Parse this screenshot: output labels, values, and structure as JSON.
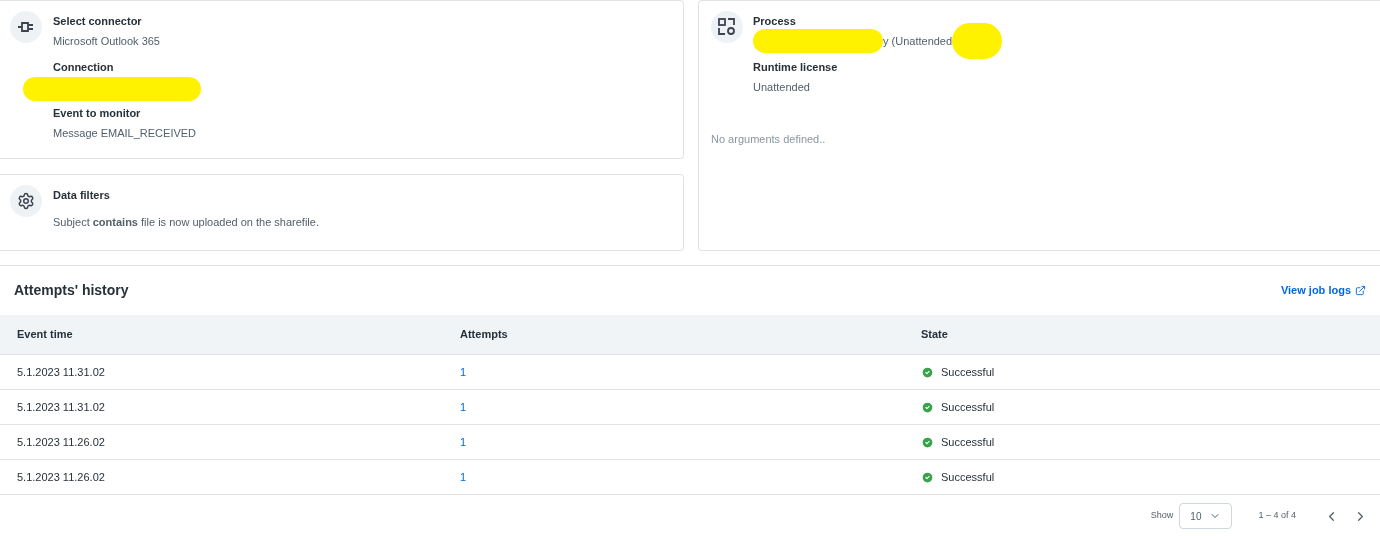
{
  "trigger_card": {
    "fields": [
      {
        "label": "Select connector",
        "value": "Microsoft Outlook 365"
      },
      {
        "label": "Connection",
        "redacted": true
      },
      {
        "label": "Event to monitor",
        "value": "Message EMAIL_RECEIVED"
      }
    ]
  },
  "filters_card": {
    "title": "Data filters",
    "text": "Subject **contains** file is now uploaded on the sharefile."
  },
  "process_card": {
    "fields": [
      {
        "label": "Process",
        "value": "y (Unattended",
        "redacted": true
      },
      {
        "label": "Runtime license",
        "value": "Unattended"
      }
    ],
    "note": "No arguments defined.."
  },
  "history": {
    "title": "Attempts' history",
    "link": "View job logs",
    "columns": [
      "Event time",
      "Attempts",
      "State"
    ],
    "rows": [
      {
        "time": "5.1.2023 11.31.02",
        "attempts": "1",
        "state": "Successful"
      },
      {
        "time": "5.1.2023 11.31.02",
        "attempts": "1",
        "state": "Successful"
      },
      {
        "time": "5.1.2023 11.26.02",
        "attempts": "1",
        "state": "Successful"
      },
      {
        "time": "5.1.2023 11.26.02",
        "attempts": "1",
        "state": "Successful"
      }
    ]
  },
  "pagination": {
    "show_label": "Show",
    "page_size": "10",
    "range": "1 – 4 of 4"
  }
}
